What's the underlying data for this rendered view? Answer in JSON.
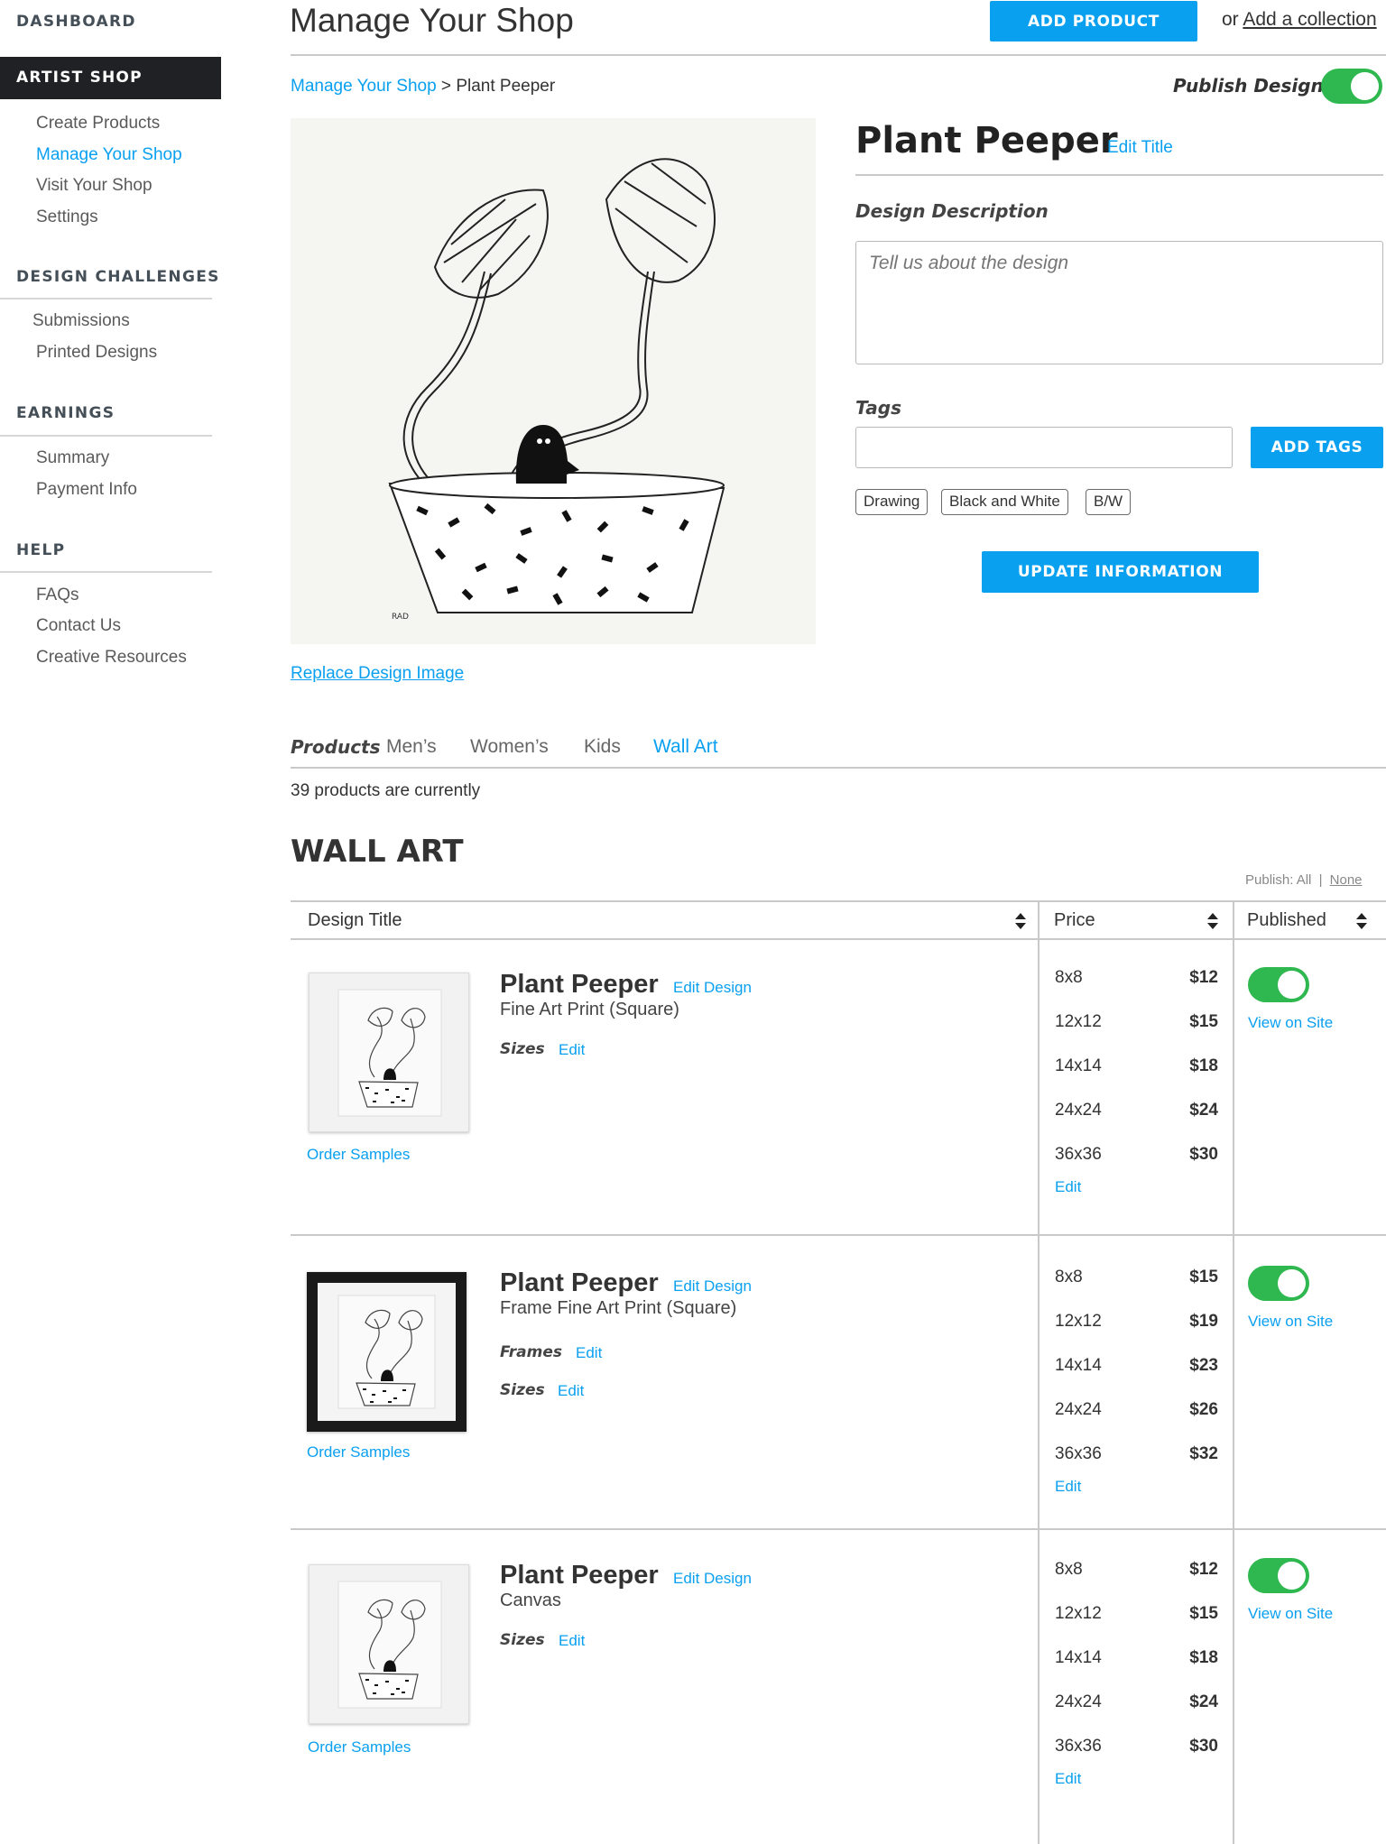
{
  "sidebar": {
    "dashboard": "DASHBOARD",
    "artist_shop": "ARTIST SHOP",
    "shop_items": [
      "Create Products",
      "Manage Your Shop",
      "Visit Your Shop",
      "Settings"
    ],
    "challenges_head": "DESIGN CHALLENGES",
    "challenges_items": [
      "Submissions",
      "Printed Designs"
    ],
    "earnings_head": "EARNINGS",
    "earnings_items": [
      "Summary",
      "Payment Info"
    ],
    "help_head": "HELP",
    "help_items": [
      "FAQs",
      "Contact Us",
      "Creative Resources"
    ]
  },
  "header": {
    "title": "Manage Your Shop",
    "add_product": "ADD PRODUCT",
    "or_text": "or",
    "add_collection": "Add a collection"
  },
  "breadcrumb": {
    "root": "Manage Your Shop",
    "sep": ">",
    "current": "Plant Peeper"
  },
  "publish": {
    "label": "Publish Design",
    "on": true
  },
  "design": {
    "title": "Plant Peeper",
    "edit_title": "Edit Title",
    "desc_label": "Design Description",
    "desc_placeholder": "Tell us about the design",
    "tags_label": "Tags",
    "tags_value": "",
    "add_tags": "ADD TAGS",
    "tags": [
      "Drawing",
      "Black and White",
      "B/W"
    ],
    "update": "UPDATE INFORMATION",
    "replace": "Replace Design Image",
    "signature": "RAD"
  },
  "tabs": {
    "label": "Products",
    "items": [
      "Men’s",
      "Women’s",
      "Kids",
      "Wall Art"
    ],
    "active": "Wall Art"
  },
  "status": "39 products are currently",
  "section": {
    "title": "WALL ART",
    "publish_label": "Publish:",
    "publish_all": "All",
    "publish_sep": "|",
    "publish_none": "None"
  },
  "table": {
    "headers": [
      "Design Title",
      "Price",
      "Published"
    ],
    "rows": [
      {
        "name": "Plant Peeper",
        "edit_design": "Edit Design",
        "type": "Fine Art Print (Square)",
        "options": [
          {
            "label": "Sizes",
            "edit": "Edit"
          }
        ],
        "order_samples": "Order Samples",
        "prices": [
          [
            "8x8",
            "$12"
          ],
          [
            "12x12",
            "$15"
          ],
          [
            "14x14",
            "$18"
          ],
          [
            "24x24",
            "$24"
          ],
          [
            "36x36",
            "$30"
          ]
        ],
        "price_edit": "Edit",
        "published": true,
        "view": "View on Site"
      },
      {
        "name": "Plant Peeper",
        "edit_design": "Edit Design",
        "type": "Frame Fine Art Print (Square)",
        "options": [
          {
            "label": "Frames",
            "edit": "Edit"
          },
          {
            "label": "Sizes",
            "edit": "Edit"
          }
        ],
        "order_samples": "Order Samples",
        "prices": [
          [
            "8x8",
            "$15"
          ],
          [
            "12x12",
            "$19"
          ],
          [
            "14x14",
            "$23"
          ],
          [
            "24x24",
            "$26"
          ],
          [
            "36x36",
            "$32"
          ]
        ],
        "price_edit": "Edit",
        "published": true,
        "view": "View on Site"
      },
      {
        "name": "Plant Peeper",
        "edit_design": "Edit Design",
        "type": "Canvas",
        "options": [
          {
            "label": "Sizes",
            "edit": "Edit"
          }
        ],
        "order_samples": "Order Samples",
        "prices": [
          [
            "8x8",
            "$12"
          ],
          [
            "12x12",
            "$15"
          ],
          [
            "14x14",
            "$18"
          ],
          [
            "24x24",
            "$24"
          ],
          [
            "36x36",
            "$30"
          ]
        ],
        "price_edit": "Edit",
        "published": true,
        "view": "View on Site"
      }
    ]
  },
  "colors": {
    "accent": "#0aa0f0",
    "toggle_on": "#2eb84f",
    "sidebar_active": "#1f2125"
  }
}
